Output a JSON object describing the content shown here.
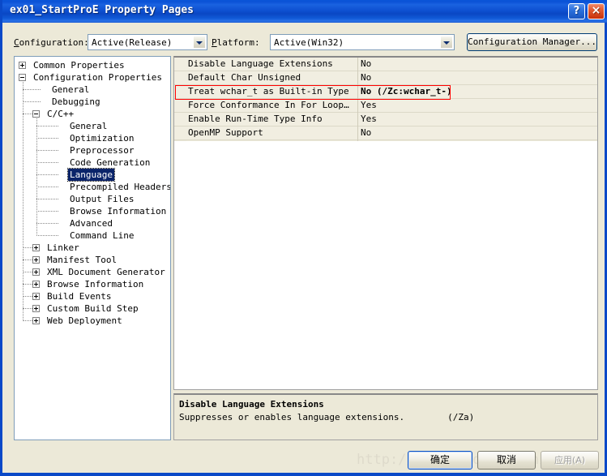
{
  "window": {
    "title": "ex01_StartProE Property Pages",
    "help_label": "?",
    "close_label": "×"
  },
  "toolbar": {
    "configuration_label": "Configuration:",
    "configuration_value": "Active(Release)",
    "platform_label": "Platform:",
    "platform_value": "Active(Win32)",
    "configuration_manager_label": "Configuration Manager..."
  },
  "tree": {
    "nodes": [
      {
        "label": "Common Properties",
        "indent": 0,
        "state": "collapsed",
        "selected": false
      },
      {
        "label": "Configuration Properties",
        "indent": 0,
        "state": "expanded",
        "selected": false
      },
      {
        "label": "General",
        "indent": 1,
        "state": "leaf",
        "selected": false
      },
      {
        "label": "Debugging",
        "indent": 1,
        "state": "leaf",
        "selected": false
      },
      {
        "label": "C/C++",
        "indent": 1,
        "state": "expanded",
        "selected": false
      },
      {
        "label": "General",
        "indent": 2,
        "state": "leaf",
        "selected": false
      },
      {
        "label": "Optimization",
        "indent": 2,
        "state": "leaf",
        "selected": false
      },
      {
        "label": "Preprocessor",
        "indent": 2,
        "state": "leaf",
        "selected": false
      },
      {
        "label": "Code Generation",
        "indent": 2,
        "state": "leaf",
        "selected": false
      },
      {
        "label": "Language",
        "indent": 2,
        "state": "leaf",
        "selected": true
      },
      {
        "label": "Precompiled Headers",
        "indent": 2,
        "state": "leaf",
        "selected": false
      },
      {
        "label": "Output Files",
        "indent": 2,
        "state": "leaf",
        "selected": false
      },
      {
        "label": "Browse Information",
        "indent": 2,
        "state": "leaf",
        "selected": false
      },
      {
        "label": "Advanced",
        "indent": 2,
        "state": "leaf",
        "selected": false
      },
      {
        "label": "Command Line",
        "indent": 2,
        "state": "leaf",
        "selected": false
      },
      {
        "label": "Linker",
        "indent": 1,
        "state": "collapsed",
        "selected": false
      },
      {
        "label": "Manifest Tool",
        "indent": 1,
        "state": "collapsed",
        "selected": false
      },
      {
        "label": "XML Document Generator",
        "indent": 1,
        "state": "collapsed",
        "selected": false
      },
      {
        "label": "Browse Information",
        "indent": 1,
        "state": "collapsed",
        "selected": false
      },
      {
        "label": "Build Events",
        "indent": 1,
        "state": "collapsed",
        "selected": false
      },
      {
        "label": "Custom Build Step",
        "indent": 1,
        "state": "collapsed",
        "selected": false
      },
      {
        "label": "Web Deployment",
        "indent": 1,
        "state": "collapsed",
        "selected": false
      }
    ]
  },
  "property_grid": {
    "rows": [
      {
        "name": "Disable Language Extensions",
        "value": "No",
        "bold": false,
        "highlighted": false
      },
      {
        "name": "Default Char Unsigned",
        "value": "No",
        "bold": false,
        "highlighted": false
      },
      {
        "name": "Treat wchar_t as Built-in Type",
        "value": "No  (/Zc:wchar_t-)",
        "bold": true,
        "highlighted": true
      },
      {
        "name": "Force Conformance In For Loop Scope",
        "value": "Yes",
        "bold": false,
        "highlighted": false
      },
      {
        "name": "Enable Run-Time Type Info",
        "value": "Yes",
        "bold": false,
        "highlighted": false
      },
      {
        "name": "OpenMP Support",
        "value": "No",
        "bold": false,
        "highlighted": false
      }
    ],
    "highlight_color": "#ff0000"
  },
  "description": {
    "title": "Disable Language Extensions",
    "body": "Suppresses or enables language extensions.        (/Za)"
  },
  "buttons": {
    "ok_label": "确定",
    "cancel_label": "取消",
    "apply_label": "应用(A)"
  },
  "watermark": {
    "text": "http://blog.csdn.net/hisong"
  }
}
